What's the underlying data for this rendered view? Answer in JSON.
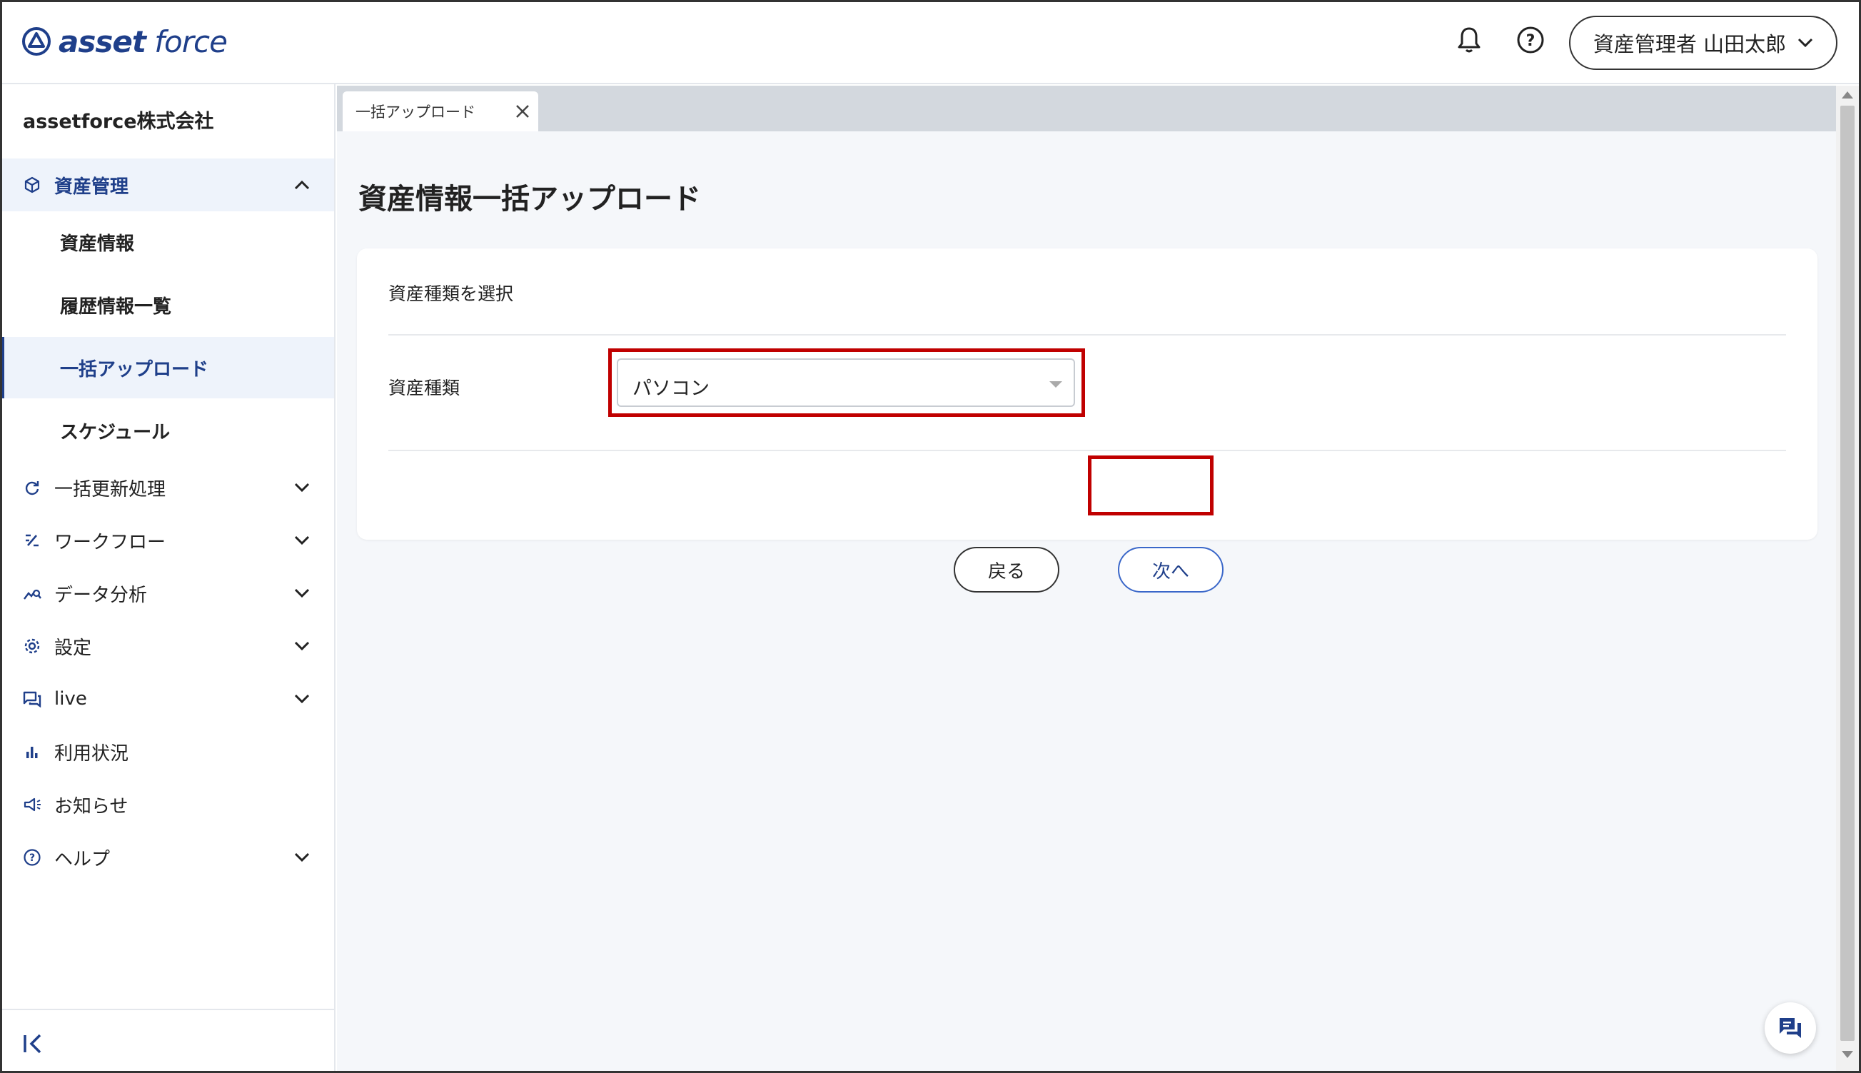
{
  "header": {
    "logo_bold": "asset",
    "logo_light": "force",
    "user_label": "資産管理者 山田太郎",
    "icons": [
      "bell-icon",
      "help-icon",
      "chevron-down-icon"
    ]
  },
  "sidebar": {
    "company": "assetforce株式会社",
    "asset_section": "資産管理",
    "sub_items": [
      {
        "label": "資産情報"
      },
      {
        "label": "履歴情報一覧"
      },
      {
        "label": "一括アップロード"
      },
      {
        "label": "スケジュール"
      }
    ],
    "sections": [
      {
        "label": "一括更新処理",
        "icon": "refresh-icon"
      },
      {
        "label": "ワークフロー",
        "icon": "workflow-icon"
      },
      {
        "label": "データ分析",
        "icon": "analytics-icon"
      },
      {
        "label": "設定",
        "icon": "gear-icon"
      },
      {
        "label": "live",
        "icon": "chat-icon"
      },
      {
        "label": "利用状況",
        "icon": "bar-chart-icon"
      },
      {
        "label": "お知らせ",
        "icon": "megaphone-icon"
      },
      {
        "label": "ヘルプ",
        "icon": "help-icon"
      }
    ]
  },
  "tabs": [
    {
      "label": "一括アップロード"
    }
  ],
  "main": {
    "title": "資産情報一括アップロード",
    "card_subtitle": "資産種類を選択",
    "field_label": "資産種類",
    "select_value": "パソコン",
    "back_label": "戻る",
    "next_label": "次へ"
  },
  "colors": {
    "brand": "#1f3f8a",
    "highlight": "#c00000",
    "active_bg": "#eef3fb"
  }
}
